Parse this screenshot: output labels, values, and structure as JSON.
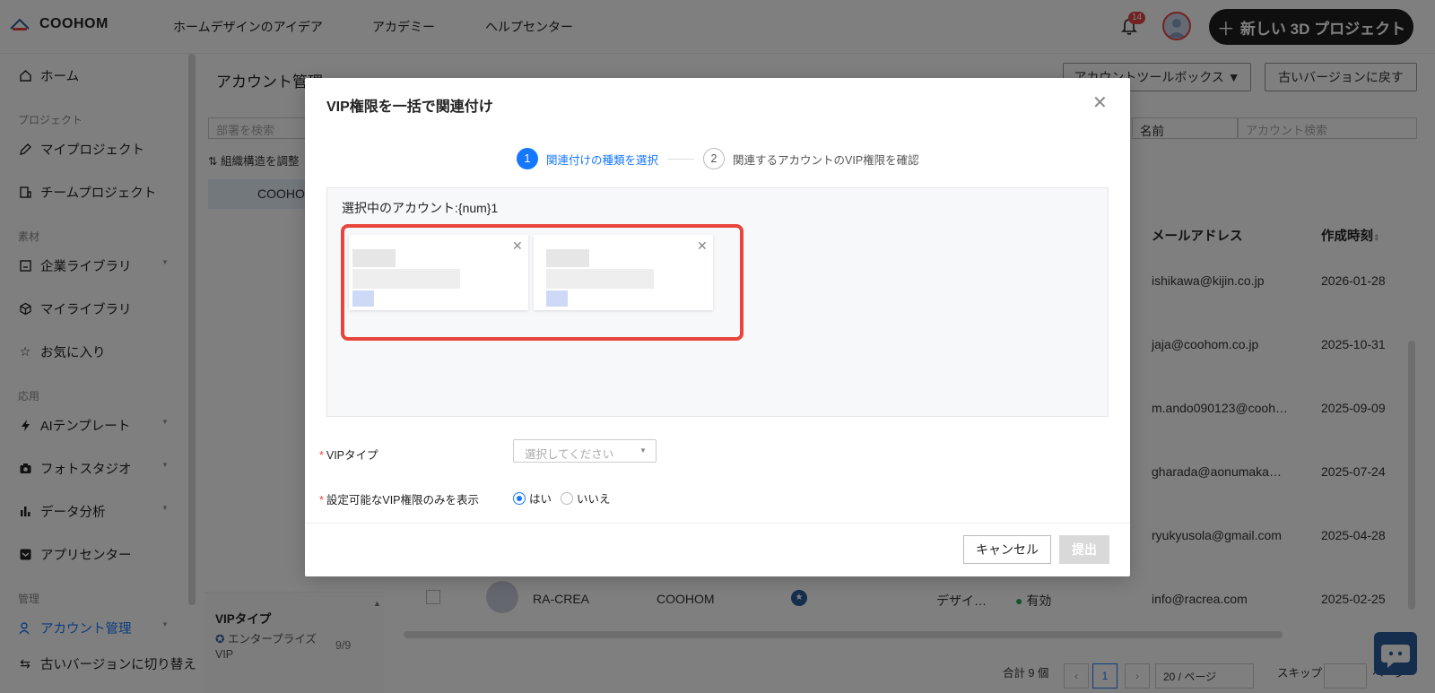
{
  "app": {
    "brand": "COOHOM"
  },
  "topnav": [
    "ホームデザインのアイデア",
    "アカデミー",
    "ヘルプセンター"
  ],
  "notifications": {
    "count": "14"
  },
  "new_project_button": "新しい 3D プロジェクト",
  "sidebar": {
    "home": "ホーム",
    "section_project": "プロジェクト",
    "my_project": "マイプロジェクト",
    "team_project": "チームプロジェクト",
    "section_material": "素材",
    "enterprise_library": "企業ライブラリ",
    "my_library": "マイライブラリ",
    "favorites": "お気に入り",
    "section_apply": "応用",
    "ai_template": "AIテンプレート",
    "photo_studio": "フォトスタジオ",
    "data_analysis": "データ分析",
    "app_center": "アプリセンター",
    "section_manage": "管理",
    "account_manage": "アカウント管理",
    "switch_old": "古いバージョンに切り替え"
  },
  "main": {
    "page_title": "アカウント管理",
    "toolbox_button": "アカウントツールボックス ▼",
    "revert_button": "古いバージョンに戻す",
    "dept_search_placeholder": "部署を検索",
    "org_adjust": "組織構造を調整",
    "org_item": "COOHOM",
    "name_select": "名前",
    "account_search_placeholder": "アカウント検索",
    "columns": {
      "email": "メールアドレス",
      "created": "作成時刻"
    },
    "rows": [
      {
        "email": "ishikawa@kijin.co.jp",
        "created": "2026-01-28"
      },
      {
        "email": "jaja@coohom.co.jp",
        "created": "2025-10-31"
      },
      {
        "email": "m.ando090123@cooh…",
        "created": "2025-09-09"
      },
      {
        "email": "gharada@aonumaka…",
        "created": "2025-07-24"
      },
      {
        "email": "ryukyusola@gmail.com",
        "created": "2025-04-28"
      },
      {
        "name": "RA-CREA",
        "org": "COOHOM",
        "role": "デザイ…",
        "status": "有効",
        "email": "info@racrea.com",
        "created": "2025-02-25"
      }
    ],
    "vip_panel": {
      "title": "VIPタイプ",
      "row_label": "エンタープライズVIP",
      "count": "9/9"
    },
    "pager": {
      "total": "合計 9 個",
      "page": "1",
      "per_page": "20 / ページ",
      "skip": "スキップ",
      "page_suffix": "ページ"
    }
  },
  "modal": {
    "title": "VIP権限を一括で関連付け",
    "steps": [
      {
        "num": "1",
        "label": "関連付けの種類を選択"
      },
      {
        "num": "2",
        "label": "関連するアカウントのVIP権限を確認"
      }
    ],
    "selected_accounts_label": "選択中のアカウント:{num}1",
    "form": {
      "vip_type_label": "VIPタイプ",
      "vip_type_placeholder": "選択してください",
      "show_only_label": "設定可能なVIP権限のみを表示",
      "yes": "はい",
      "no": "いいえ"
    },
    "cancel": "キャンセル",
    "submit": "提出"
  },
  "colors": {
    "accent": "#1677ff",
    "highlight_frame": "#e8453c",
    "badge": "#e64545"
  }
}
